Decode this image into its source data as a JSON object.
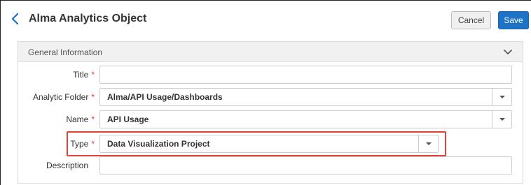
{
  "header": {
    "title": "Alma Analytics Object",
    "cancel_label": "Cancel",
    "save_label": "Save"
  },
  "panel": {
    "title": "General Information",
    "fields": {
      "title": {
        "label": "Title",
        "required_mark": "*",
        "value": ""
      },
      "analytic_folder": {
        "label": "Analytic Folder",
        "required_mark": "*",
        "value": "Alma/API Usage/Dashboards"
      },
      "name": {
        "label": "Name",
        "required_mark": "*",
        "value": "API Usage"
      },
      "type": {
        "label": "Type",
        "required_mark": "*",
        "value": "Data Visualization Project"
      },
      "description": {
        "label": "Description",
        "value": ""
      }
    }
  },
  "colors": {
    "accent": "#1f73c6",
    "required": "#e03a3a",
    "highlight": "#e2403a"
  },
  "icons": {
    "back": "chevron-left-icon",
    "collapse": "chevron-down-icon",
    "dropdown": "caret-down-icon"
  }
}
